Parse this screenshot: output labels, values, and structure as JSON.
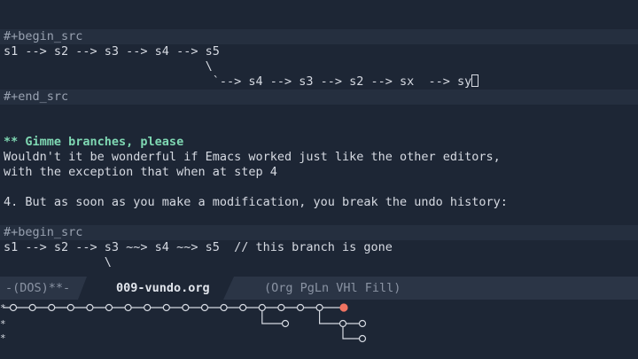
{
  "editor": {
    "lines": [
      {
        "text": "#+begin_src",
        "kind": "block"
      },
      {
        "text": "s1 --> s2 --> s3 --> s4 --> s5",
        "kind": "code"
      },
      {
        "text": "                            \\",
        "kind": "code"
      },
      {
        "text": "                             `--> s4 --> s3 --> s2 --> sx  --> sy",
        "kind": "code"
      },
      {
        "text": "#+end_src",
        "kind": "block"
      },
      {
        "text": "",
        "kind": "blank"
      },
      {
        "text": "",
        "kind": "blank"
      },
      {
        "text": "** Gimme branches, please",
        "kind": "heading"
      },
      {
        "text": "Wouldn't it be wonderful if Emacs worked just like the other editors,",
        "kind": "text"
      },
      {
        "text": "with the exception that when at step 4",
        "kind": "text"
      },
      {
        "text": "",
        "kind": "blank"
      },
      {
        "text": "4. But as soon as you make a modification, you break the undo history:",
        "kind": "text"
      },
      {
        "text": "",
        "kind": "blank"
      },
      {
        "text": "#+begin_src",
        "kind": "block"
      },
      {
        "text": "s1 --> s2 --> s3 ~~> s4 ~~> s5  // this branch is gone",
        "kind": "code"
      },
      {
        "text": "              \\",
        "kind": "code"
      }
    ]
  },
  "modeline": {
    "status": "-(DOS)**-",
    "buffer": "009-vundo.org",
    "modes": "(Org PgLn VHl Fill)"
  },
  "vundo": {
    "gutter": [
      "*",
      "*",
      "*"
    ],
    "active_color": "#f07462"
  },
  "colors": {
    "background": "#1d2635",
    "block_bg": "#252f3f",
    "heading": "#7fd8b3"
  }
}
